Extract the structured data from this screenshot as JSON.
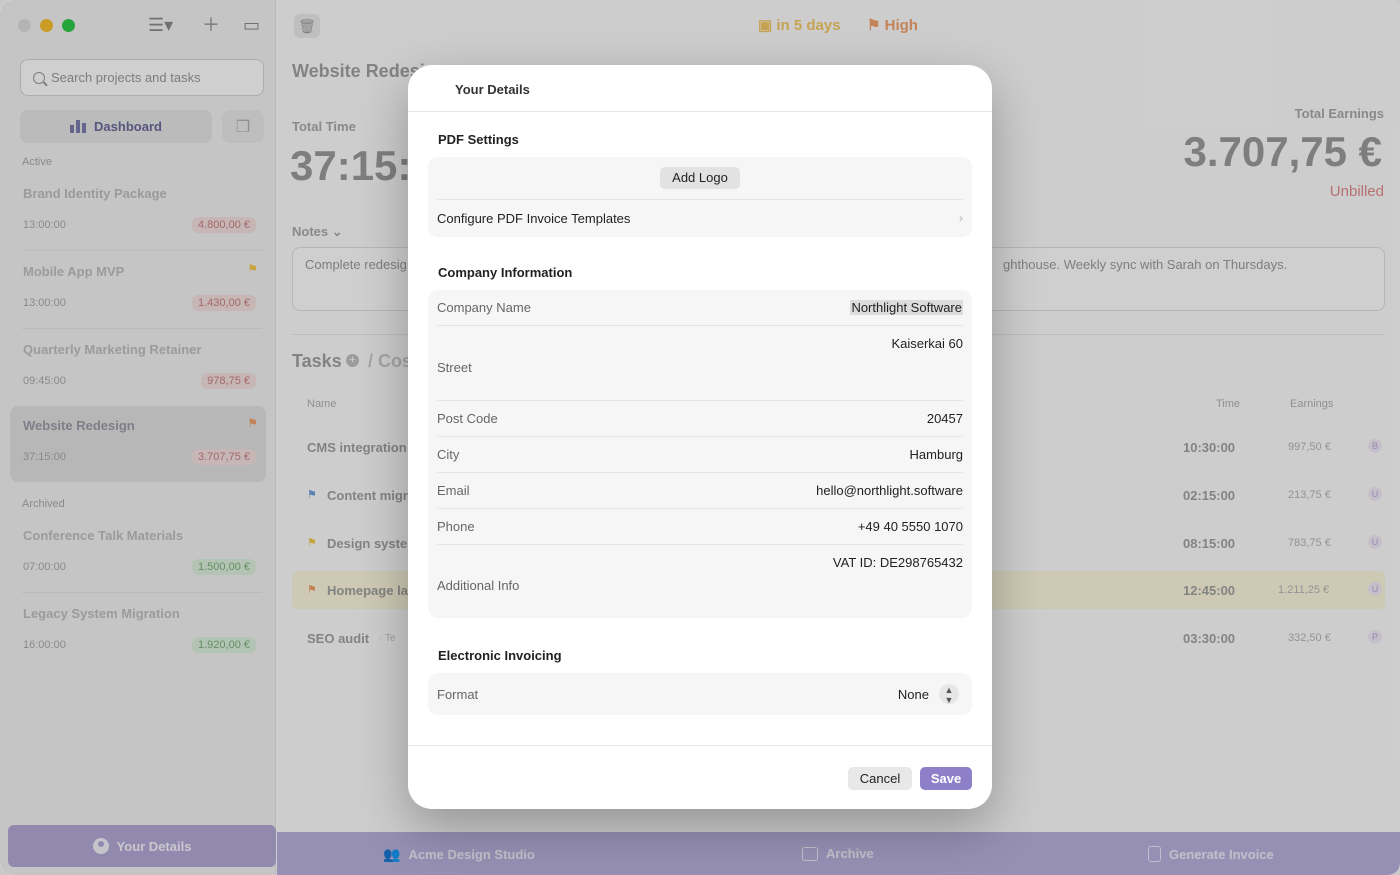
{
  "sidebar": {
    "search_placeholder": "Search projects and tasks",
    "dashboard_label": "Dashboard",
    "active_label": "Active",
    "archived_label": "Archived",
    "projects_active": [
      {
        "name": "Brand Identity Package",
        "time": "13:00:00",
        "earnings": "4.800,00 €",
        "flag": false
      },
      {
        "name": "Mobile App MVP",
        "time": "13:00:00",
        "earnings": "1.430,00 €",
        "flag": true,
        "flag_color": "#f2c94c"
      },
      {
        "name": "Quarterly Marketing Retainer",
        "time": "09:45:00",
        "earnings": "978,75 €",
        "flag": false
      },
      {
        "name": "Website Redesign",
        "time": "37:15:00",
        "earnings": "3.707,75 €",
        "flag": true,
        "flag_color": "#f0a06a"
      }
    ],
    "projects_archived": [
      {
        "name": "Conference Talk Materials",
        "time": "07:00:00",
        "earnings": "1.500,00 €"
      },
      {
        "name": "Legacy System Migration",
        "time": "16:00:00",
        "earnings": "1.920,00 €"
      }
    ],
    "your_details_label": "Your Details"
  },
  "toolbar": {
    "due": "in 5 days",
    "priority": "High"
  },
  "main": {
    "project_title": "Website Redesi",
    "total_time_label": "Total Time",
    "total_time_value": "37:15:0",
    "total_earnings_label": "Total Earnings",
    "total_earnings_value": "3.707,75 €",
    "unbilled_label": "Unbilled",
    "notes_label": "Notes",
    "notes_text_left": "Complete redesig",
    "notes_text_right": "ghthouse. Weekly sync with Sarah on Thursdays.",
    "tasks_label": "Tasks",
    "costs_label": "Cos",
    "columns": {
      "name": "Name",
      "time": "Time",
      "earnings": "Earnings"
    },
    "tasks": [
      {
        "name": "CMS integration",
        "time": "10:30:00",
        "earnings": "997,50 €",
        "badge": "B",
        "flag": ""
      },
      {
        "name": "Content migr",
        "time": "02:15:00",
        "earnings": "213,75 €",
        "badge": "U",
        "flag": "#6a9ee0"
      },
      {
        "name": "Design syste",
        "time": "08:15:00",
        "earnings": "783,75 €",
        "badge": "U",
        "flag": "#f2c94c"
      },
      {
        "name": "Homepage la",
        "time": "12:45:00",
        "earnings": "1.211,25 €",
        "badge": "U",
        "flag": "#f0a06a"
      },
      {
        "name": "SEO audit",
        "time": "03:30:00",
        "earnings": "332,50 €",
        "badge": "P",
        "flag": "",
        "meta": "Te"
      }
    ]
  },
  "bottom_bar": {
    "client": "Acme Design Studio",
    "archive": "Archive",
    "generate": "Generate Invoice"
  },
  "modal": {
    "title": "Your Details",
    "pdf_settings_title": "PDF Settings",
    "add_logo": "Add Logo",
    "configure_templates": "Configure PDF Invoice Templates",
    "company_info_title": "Company Information",
    "fields": {
      "company_name_label": "Company Name",
      "company_name_value": "Northlight Software",
      "street_label": "Street",
      "street_value": "Kaiserkai 60",
      "post_code_label": "Post Code",
      "post_code_value": "20457",
      "city_label": "City",
      "city_value": "Hamburg",
      "email_label": "Email",
      "email_value": "hello@northlight.software",
      "phone_label": "Phone",
      "phone_value": "+49 40 5550 1070",
      "additional_label": "Additional Info",
      "additional_value": "VAT ID: DE298765432"
    },
    "einvoicing_title": "Electronic Invoicing",
    "format_label": "Format",
    "format_value": "None",
    "cancel": "Cancel",
    "save": "Save"
  }
}
